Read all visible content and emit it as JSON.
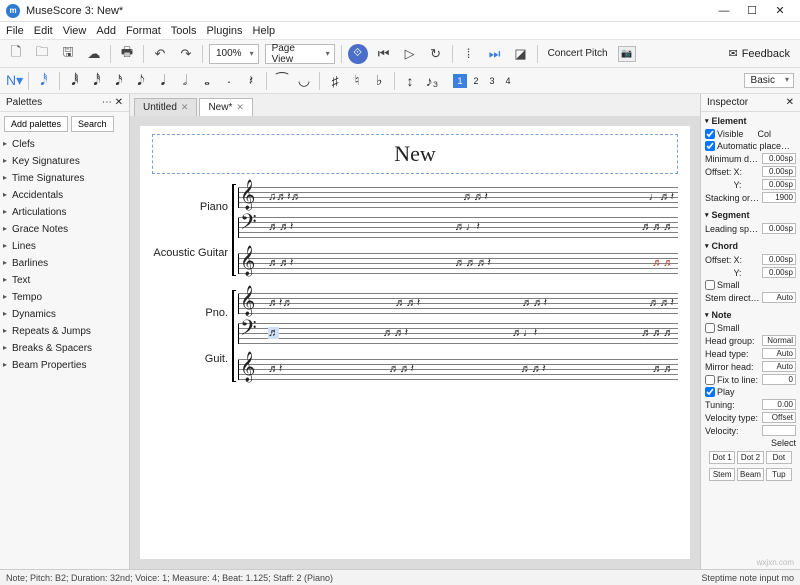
{
  "window": {
    "title": "MuseScore 3: New*"
  },
  "menu": [
    "File",
    "Edit",
    "View",
    "Add",
    "Format",
    "Tools",
    "Plugins",
    "Help"
  ],
  "toolbar": {
    "zoom": "100%",
    "view_mode": "Page View",
    "concert_pitch": "Concert Pitch",
    "feedback": "Feedback"
  },
  "voices": [
    "1",
    "2",
    "3",
    "4"
  ],
  "workspace": "Basic",
  "palettes": {
    "title": "Palettes",
    "add_btn": "Add palettes",
    "search_btn": "Search",
    "items": [
      "Clefs",
      "Key Signatures",
      "Time Signatures",
      "Accidentals",
      "Articulations",
      "Grace Notes",
      "Lines",
      "Barlines",
      "Text",
      "Tempo",
      "Dynamics",
      "Repeats & Jumps",
      "Breaks & Spacers",
      "Beam Properties"
    ]
  },
  "tabs": [
    {
      "label": "Untitled",
      "active": false
    },
    {
      "label": "New*",
      "active": true
    }
  ],
  "score": {
    "title": "New",
    "system1": {
      "inst1": "Piano",
      "inst2": "Acoustic Guitar"
    },
    "system2": {
      "inst1": "Pno.",
      "inst2": "Guit."
    }
  },
  "inspector": {
    "title": "Inspector",
    "element": {
      "title": "Element",
      "visible_label": "Visible",
      "col_label": "Col",
      "auto_label": "Automatic placement",
      "min_dist_label": "Minimum distance:",
      "min_dist": "0.00sp",
      "offset_label": "Offset:",
      "offx": "0.00sp",
      "offy": "0.00sp",
      "x_label": "X:",
      "y_label": "Y:",
      "stacking_label": "Stacking order (Z):",
      "stacking": "1900"
    },
    "segment": {
      "title": "Segment",
      "leading_label": "Leading space:",
      "leading": "0.00sp"
    },
    "chord": {
      "title": "Chord",
      "offset_label": "Offset:",
      "x_label": "X:",
      "y_label": "Y:",
      "offx": "0.00sp",
      "offy": "0.00sp",
      "small_label": "Small",
      "stem_dir_label": "Stem direction:",
      "stem_dir": "Auto"
    },
    "note": {
      "title": "Note",
      "small_label": "Small",
      "head_group_label": "Head group:",
      "head_group": "Normal",
      "head_type_label": "Head type:",
      "head_type": "Auto",
      "mirror_label": "Mirror head:",
      "mirror": "Auto",
      "fix_line_label": "Fix to line:",
      "fix_line": "0",
      "play_label": "Play",
      "tuning_label": "Tuning:",
      "tuning": "0.00",
      "vel_type_label": "Velocity type:",
      "vel_type": "Offset",
      "velocity_label": "Velocity:",
      "select_label": "Select",
      "dot1": "Dot 1",
      "dot2": "Dot 2",
      "dot3": "Dot",
      "stem": "Stem",
      "beam": "Beam",
      "tup": "Tup"
    }
  },
  "status": {
    "left": "Note; Pitch: B2; Duration: 32nd; Voice: 1; Measure: 4; Beat: 1.125; Staff: 2 (Piano)",
    "right": "Steptime note input mo"
  }
}
